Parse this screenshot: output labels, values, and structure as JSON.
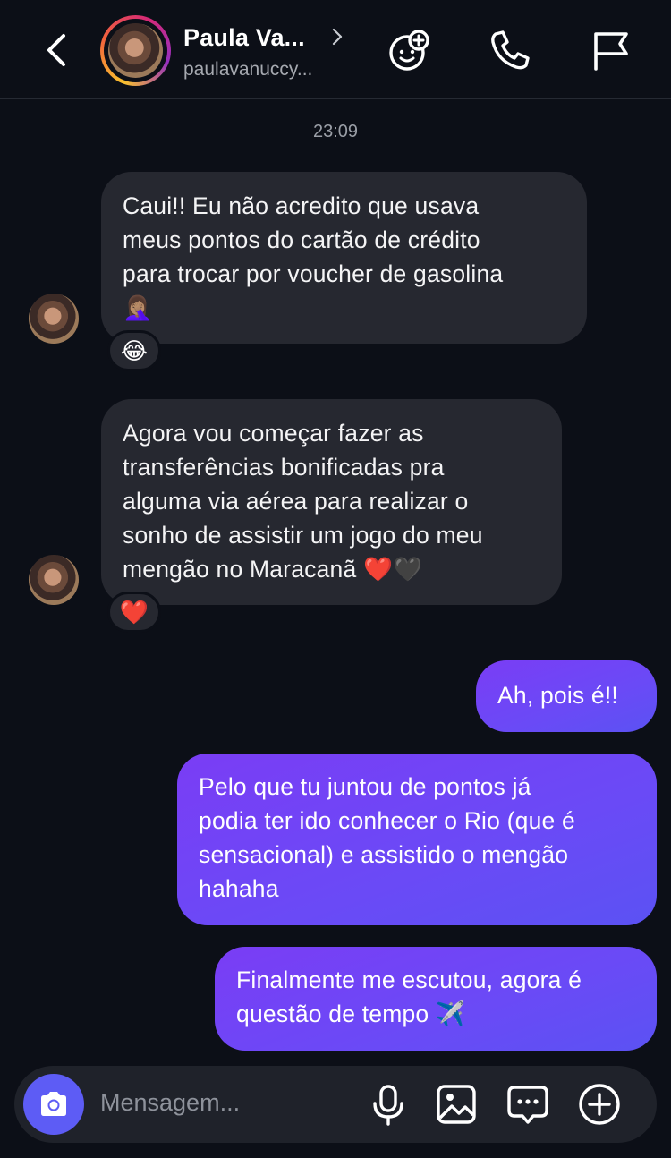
{
  "header": {
    "name": "Paula Va...",
    "handle": "paulavanuccy..."
  },
  "timestamp": "23:09",
  "messages": {
    "m1": {
      "line1": "Caui!! Eu não acredito que usava",
      "line2": "meus pontos do cartão de crédito",
      "line3": "para trocar por voucher de gasolina",
      "emoji": "🤦🏽‍♀️",
      "reaction": "😂"
    },
    "m2": {
      "line1": "Agora vou começar fazer as",
      "line2": "transferências bonificadas pra",
      "line3": "alguma via aérea para realizar o",
      "line4": "sonho de assistir um jogo do meu",
      "line5": "mengão no Maracanã ❤️🖤",
      "reaction": "❤️"
    },
    "m3": {
      "text": "Ah, pois é!!"
    },
    "m4": {
      "line1": "Pelo que tu juntou de pontos já",
      "line2": "podia ter ido conhecer o Rio (que é",
      "line3": "sensacional) e assistido o mengão",
      "line4": "hahaha"
    },
    "m5": {
      "line1": "Finalmente me escutou, agora é",
      "line2": "questão de tempo ✈️"
    }
  },
  "composer": {
    "placeholder": "Mensagem..."
  },
  "colors": {
    "background": "#0c0f17",
    "incoming_bubble": "#262830",
    "outgoing_bubble": "#6a4af6",
    "camera_button": "#5d5cf5"
  }
}
